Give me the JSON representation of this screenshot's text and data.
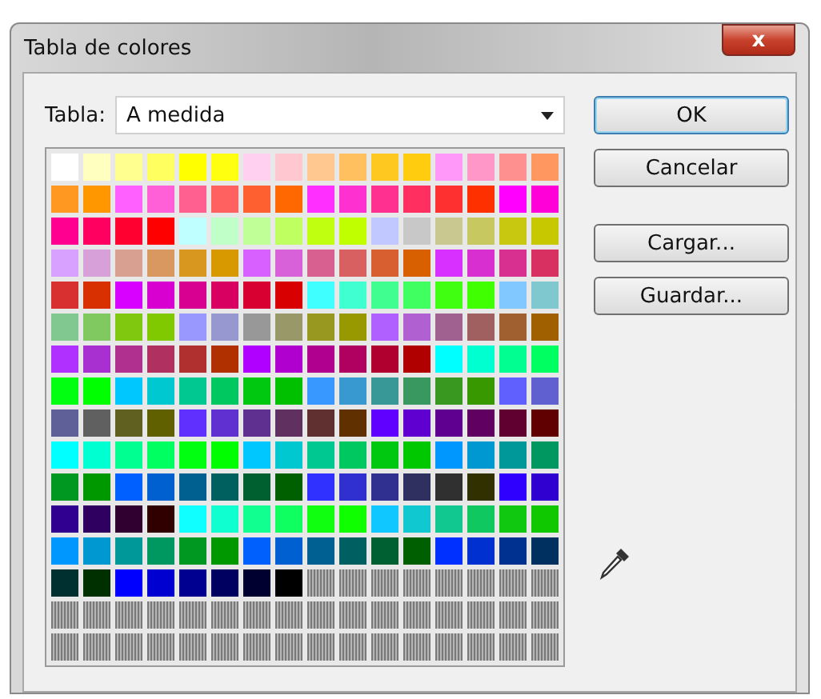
{
  "window": {
    "title": "Tabla de colores",
    "close": "x"
  },
  "table_selector": {
    "label": "Tabla:",
    "value": "A medida"
  },
  "swatches": [
    {
      "kind": "color",
      "color": "#ffffff"
    },
    {
      "kind": "color",
      "color": "#ffffc0"
    },
    {
      "kind": "color",
      "color": "#ffff90"
    },
    {
      "kind": "color",
      "color": "#ffff60"
    },
    {
      "kind": "color",
      "color": "#ffff00"
    },
    {
      "kind": "color",
      "color": "#ffff10"
    },
    {
      "kind": "color",
      "color": "#ffd0f0"
    },
    {
      "kind": "color",
      "color": "#ffc8d0"
    },
    {
      "kind": "color",
      "color": "#ffc890"
    },
    {
      "kind": "color",
      "color": "#ffc060"
    },
    {
      "kind": "color",
      "color": "#ffc820"
    },
    {
      "kind": "color",
      "color": "#ffcc10"
    },
    {
      "kind": "color",
      "color": "#ff98f8"
    },
    {
      "kind": "color",
      "color": "#ff98c8"
    },
    {
      "kind": "color",
      "color": "#ff9090"
    },
    {
      "kind": "color",
      "color": "#ff9860"
    },
    {
      "kind": "color",
      "color": "#ff9820"
    },
    {
      "kind": "color",
      "color": "#ff9800"
    },
    {
      "kind": "color",
      "color": "#ff60ff"
    },
    {
      "kind": "color",
      "color": "#ff60d8"
    },
    {
      "kind": "color",
      "color": "#ff6090"
    },
    {
      "kind": "color",
      "color": "#ff6060"
    },
    {
      "kind": "color",
      "color": "#ff6030"
    },
    {
      "kind": "color",
      "color": "#ff6800"
    },
    {
      "kind": "color",
      "color": "#ff30ff"
    },
    {
      "kind": "color",
      "color": "#ff30d0"
    },
    {
      "kind": "color",
      "color": "#ff3090"
    },
    {
      "kind": "color",
      "color": "#ff3060"
    },
    {
      "kind": "color",
      "color": "#ff3030"
    },
    {
      "kind": "color",
      "color": "#ff3000"
    },
    {
      "kind": "color",
      "color": "#ff00ff"
    },
    {
      "kind": "color",
      "color": "#ff00d8"
    },
    {
      "kind": "color",
      "color": "#ff0090"
    },
    {
      "kind": "color",
      "color": "#ff0060"
    },
    {
      "kind": "color",
      "color": "#ff0030"
    },
    {
      "kind": "color",
      "color": "#ff0000"
    },
    {
      "kind": "color",
      "color": "#c0ffff"
    },
    {
      "kind": "color",
      "color": "#c0ffc8"
    },
    {
      "kind": "color",
      "color": "#c0ff98"
    },
    {
      "kind": "color",
      "color": "#c0ff60"
    },
    {
      "kind": "color",
      "color": "#c0ff10"
    },
    {
      "kind": "color",
      "color": "#c0ff00"
    },
    {
      "kind": "color",
      "color": "#c0c8ff"
    },
    {
      "kind": "color",
      "color": "#c8c8c8"
    },
    {
      "kind": "color",
      "color": "#c8c890"
    },
    {
      "kind": "color",
      "color": "#c8c860"
    },
    {
      "kind": "color",
      "color": "#c8c810"
    },
    {
      "kind": "color",
      "color": "#c8c800"
    },
    {
      "kind": "color",
      "color": "#d8a0ff"
    },
    {
      "kind": "color",
      "color": "#d8a0d8"
    },
    {
      "kind": "color",
      "color": "#d8a090"
    },
    {
      "kind": "color",
      "color": "#d89860"
    },
    {
      "kind": "color",
      "color": "#d89820"
    },
    {
      "kind": "color",
      "color": "#d89800"
    },
    {
      "kind": "color",
      "color": "#d860ff"
    },
    {
      "kind": "color",
      "color": "#d860d8"
    },
    {
      "kind": "color",
      "color": "#d86090"
    },
    {
      "kind": "color",
      "color": "#d86060"
    },
    {
      "kind": "color",
      "color": "#d86030"
    },
    {
      "kind": "color",
      "color": "#d86000"
    },
    {
      "kind": "color",
      "color": "#d830ff"
    },
    {
      "kind": "color",
      "color": "#d830d0"
    },
    {
      "kind": "color",
      "color": "#d83090"
    },
    {
      "kind": "color",
      "color": "#d83060"
    },
    {
      "kind": "color",
      "color": "#d83030"
    },
    {
      "kind": "color",
      "color": "#d83000"
    },
    {
      "kind": "color",
      "color": "#d800ff"
    },
    {
      "kind": "color",
      "color": "#d800d0"
    },
    {
      "kind": "color",
      "color": "#d80090"
    },
    {
      "kind": "color",
      "color": "#d80060"
    },
    {
      "kind": "color",
      "color": "#d80030"
    },
    {
      "kind": "color",
      "color": "#d80000"
    },
    {
      "kind": "color",
      "color": "#40ffff"
    },
    {
      "kind": "color",
      "color": "#40ffd0"
    },
    {
      "kind": "color",
      "color": "#40ff90"
    },
    {
      "kind": "color",
      "color": "#40ff60"
    },
    {
      "kind": "color",
      "color": "#40ff10"
    },
    {
      "kind": "color",
      "color": "#40ff00"
    },
    {
      "kind": "color",
      "color": "#80c8ff"
    },
    {
      "kind": "color",
      "color": "#80c8d0"
    },
    {
      "kind": "color",
      "color": "#80c890"
    },
    {
      "kind": "color",
      "color": "#80c860"
    },
    {
      "kind": "color",
      "color": "#80c810"
    },
    {
      "kind": "color",
      "color": "#80c800"
    },
    {
      "kind": "color",
      "color": "#9898ff"
    },
    {
      "kind": "color",
      "color": "#9898d0"
    },
    {
      "kind": "color",
      "color": "#989898"
    },
    {
      "kind": "color",
      "color": "#989868"
    },
    {
      "kind": "color",
      "color": "#989820"
    },
    {
      "kind": "color",
      "color": "#989800"
    },
    {
      "kind": "color",
      "color": "#b060ff"
    },
    {
      "kind": "color",
      "color": "#b060d0"
    },
    {
      "kind": "color",
      "color": "#a06090"
    },
    {
      "kind": "color",
      "color": "#a06060"
    },
    {
      "kind": "color",
      "color": "#a06030"
    },
    {
      "kind": "color",
      "color": "#a06000"
    },
    {
      "kind": "color",
      "color": "#b030ff"
    },
    {
      "kind": "color",
      "color": "#a830d0"
    },
    {
      "kind": "color",
      "color": "#b03090"
    },
    {
      "kind": "color",
      "color": "#b03060"
    },
    {
      "kind": "color",
      "color": "#b03030"
    },
    {
      "kind": "color",
      "color": "#b03000"
    },
    {
      "kind": "color",
      "color": "#b000ff"
    },
    {
      "kind": "color",
      "color": "#b000d0"
    },
    {
      "kind": "color",
      "color": "#b00090"
    },
    {
      "kind": "color",
      "color": "#b00060"
    },
    {
      "kind": "color",
      "color": "#b00030"
    },
    {
      "kind": "color",
      "color": "#b00000"
    },
    {
      "kind": "color",
      "color": "#00ffff"
    },
    {
      "kind": "color",
      "color": "#00ffd0"
    },
    {
      "kind": "color",
      "color": "#00ff90"
    },
    {
      "kind": "color",
      "color": "#00ff60"
    },
    {
      "kind": "color",
      "color": "#00ff10"
    },
    {
      "kind": "color",
      "color": "#00ff00"
    },
    {
      "kind": "color",
      "color": "#00c8ff"
    },
    {
      "kind": "color",
      "color": "#00c8d0"
    },
    {
      "kind": "color",
      "color": "#00c890"
    },
    {
      "kind": "color",
      "color": "#00c860"
    },
    {
      "kind": "color",
      "color": "#00c810"
    },
    {
      "kind": "color",
      "color": "#00c000"
    },
    {
      "kind": "color",
      "color": "#3898ff"
    },
    {
      "kind": "color",
      "color": "#3898d0"
    },
    {
      "kind": "color",
      "color": "#389898"
    },
    {
      "kind": "color",
      "color": "#389860"
    },
    {
      "kind": "color",
      "color": "#389820"
    },
    {
      "kind": "color",
      "color": "#389800"
    },
    {
      "kind": "color",
      "color": "#6060ff"
    },
    {
      "kind": "color",
      "color": "#6060d0"
    },
    {
      "kind": "color",
      "color": "#606098"
    },
    {
      "kind": "color",
      "color": "#606060"
    },
    {
      "kind": "color",
      "color": "#606020"
    },
    {
      "kind": "color",
      "color": "#606000"
    },
    {
      "kind": "color",
      "color": "#6030ff"
    },
    {
      "kind": "color",
      "color": "#6030d0"
    },
    {
      "kind": "color",
      "color": "#603090"
    },
    {
      "kind": "color",
      "color": "#603060"
    },
    {
      "kind": "color",
      "color": "#603030"
    },
    {
      "kind": "color",
      "color": "#603000"
    },
    {
      "kind": "color",
      "color": "#6000ff"
    },
    {
      "kind": "color",
      "color": "#6000d0"
    },
    {
      "kind": "color",
      "color": "#600090"
    },
    {
      "kind": "color",
      "color": "#600060"
    },
    {
      "kind": "color",
      "color": "#600030"
    },
    {
      "kind": "color",
      "color": "#600000"
    },
    {
      "kind": "color",
      "color": "#00fffe"
    },
    {
      "kind": "color",
      "color": "#00ffd1"
    },
    {
      "kind": "color",
      "color": "#00ff91"
    },
    {
      "kind": "color",
      "color": "#00ff61"
    },
    {
      "kind": "color",
      "color": "#00ff11"
    },
    {
      "kind": "color",
      "color": "#00fe00"
    },
    {
      "kind": "color",
      "color": "#00c8fe"
    },
    {
      "kind": "color",
      "color": "#00c8d1"
    },
    {
      "kind": "color",
      "color": "#00c891"
    },
    {
      "kind": "color",
      "color": "#00c861"
    },
    {
      "kind": "color",
      "color": "#00c811"
    },
    {
      "kind": "color",
      "color": "#00c800"
    },
    {
      "kind": "color",
      "color": "#0098ff"
    },
    {
      "kind": "color",
      "color": "#0098d0"
    },
    {
      "kind": "color",
      "color": "#009898"
    },
    {
      "kind": "color",
      "color": "#009860"
    },
    {
      "kind": "color",
      "color": "#009820"
    },
    {
      "kind": "color",
      "color": "#009800"
    },
    {
      "kind": "color",
      "color": "#0060ff"
    },
    {
      "kind": "color",
      "color": "#0060d0"
    },
    {
      "kind": "color",
      "color": "#006090"
    },
    {
      "kind": "color",
      "color": "#006060"
    },
    {
      "kind": "color",
      "color": "#006030"
    },
    {
      "kind": "color",
      "color": "#006000"
    },
    {
      "kind": "color",
      "color": "#3030ff"
    },
    {
      "kind": "color",
      "color": "#3030d0"
    },
    {
      "kind": "color",
      "color": "#303090"
    },
    {
      "kind": "color",
      "color": "#303060"
    },
    {
      "kind": "color",
      "color": "#303030"
    },
    {
      "kind": "color",
      "color": "#303000"
    },
    {
      "kind": "color",
      "color": "#3000ff"
    },
    {
      "kind": "color",
      "color": "#3000d0"
    },
    {
      "kind": "color",
      "color": "#300090"
    },
    {
      "kind": "color",
      "color": "#300060"
    },
    {
      "kind": "color",
      "color": "#300030"
    },
    {
      "kind": "color",
      "color": "#300000"
    },
    {
      "kind": "color",
      "color": "#10ffff"
    },
    {
      "kind": "color",
      "color": "#10ffd0"
    },
    {
      "kind": "color",
      "color": "#10ff90"
    },
    {
      "kind": "color",
      "color": "#10ff60"
    },
    {
      "kind": "color",
      "color": "#10ff10"
    },
    {
      "kind": "color",
      "color": "#10ff00"
    },
    {
      "kind": "color",
      "color": "#10c8ff"
    },
    {
      "kind": "color",
      "color": "#10c8d0"
    },
    {
      "kind": "color",
      "color": "#10c890"
    },
    {
      "kind": "color",
      "color": "#10c860"
    },
    {
      "kind": "color",
      "color": "#10c810"
    },
    {
      "kind": "color",
      "color": "#10c800"
    },
    {
      "kind": "color",
      "color": "#0098fe"
    },
    {
      "kind": "color",
      "color": "#0098d1"
    },
    {
      "kind": "color",
      "color": "#009899"
    },
    {
      "kind": "color",
      "color": "#009861"
    },
    {
      "kind": "color",
      "color": "#009821"
    },
    {
      "kind": "color",
      "color": "#009801"
    },
    {
      "kind": "color",
      "color": "#0060fe"
    },
    {
      "kind": "color",
      "color": "#0060d1"
    },
    {
      "kind": "color",
      "color": "#006091"
    },
    {
      "kind": "color",
      "color": "#006061"
    },
    {
      "kind": "color",
      "color": "#006031"
    },
    {
      "kind": "color",
      "color": "#006001"
    },
    {
      "kind": "color",
      "color": "#0030ff"
    },
    {
      "kind": "color",
      "color": "#0030d0"
    },
    {
      "kind": "color",
      "color": "#003090"
    },
    {
      "kind": "color",
      "color": "#003060"
    },
    {
      "kind": "color",
      "color": "#003030"
    },
    {
      "kind": "color",
      "color": "#003000"
    },
    {
      "kind": "color",
      "color": "#0000ff"
    },
    {
      "kind": "color",
      "color": "#0000d0"
    },
    {
      "kind": "color",
      "color": "#000090"
    },
    {
      "kind": "color",
      "color": "#000060"
    },
    {
      "kind": "color",
      "color": "#000030"
    },
    {
      "kind": "color",
      "color": "#000000"
    },
    {
      "kind": "empty"
    },
    {
      "kind": "empty"
    },
    {
      "kind": "empty"
    },
    {
      "kind": "empty"
    },
    {
      "kind": "empty"
    },
    {
      "kind": "empty"
    },
    {
      "kind": "empty"
    },
    {
      "kind": "empty"
    },
    {
      "kind": "empty"
    },
    {
      "kind": "empty"
    },
    {
      "kind": "empty"
    },
    {
      "kind": "empty"
    },
    {
      "kind": "empty"
    },
    {
      "kind": "empty"
    },
    {
      "kind": "empty"
    },
    {
      "kind": "empty"
    },
    {
      "kind": "empty"
    },
    {
      "kind": "empty"
    },
    {
      "kind": "empty"
    },
    {
      "kind": "empty"
    },
    {
      "kind": "empty"
    },
    {
      "kind": "empty"
    },
    {
      "kind": "empty"
    },
    {
      "kind": "empty"
    },
    {
      "kind": "empty"
    },
    {
      "kind": "empty"
    },
    {
      "kind": "empty"
    },
    {
      "kind": "empty"
    },
    {
      "kind": "empty"
    },
    {
      "kind": "empty"
    },
    {
      "kind": "empty"
    },
    {
      "kind": "empty"
    },
    {
      "kind": "empty"
    },
    {
      "kind": "empty"
    },
    {
      "kind": "empty"
    },
    {
      "kind": "empty"
    },
    {
      "kind": "empty"
    },
    {
      "kind": "empty"
    },
    {
      "kind": "empty"
    },
    {
      "kind": "empty"
    }
  ],
  "buttons": [
    {
      "label": "OK",
      "default": true
    },
    {
      "label": "Cancelar",
      "default": false
    },
    {
      "label": "Cargar...",
      "default": false
    },
    {
      "label": "Guardar...",
      "default": false
    }
  ]
}
